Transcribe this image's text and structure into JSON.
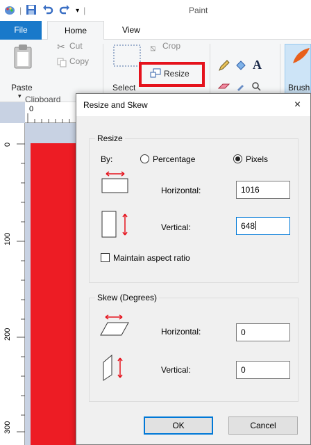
{
  "window": {
    "title": "Paint"
  },
  "ribbon_tabs": {
    "file": "File",
    "home": "Home",
    "view": "View"
  },
  "ribbon": {
    "paste": "Paste",
    "cut": "Cut",
    "copy": "Copy",
    "select": "Select",
    "crop": "Crop",
    "resize": "Resize",
    "clipboard_group": "Clipboard",
    "brushes": "Brush"
  },
  "rulers": {
    "top_zero": "0",
    "left_marks": [
      "0",
      "100",
      "200",
      "300"
    ]
  },
  "dialog": {
    "title": "Resize and Skew",
    "close": "×",
    "resize_group": {
      "label": "Resize",
      "by_label": "By:",
      "percentage": "Percentage",
      "pixels": "Pixels",
      "selected": "Pixels",
      "horizontal_label": "Horizontal:",
      "horizontal_value": "1016",
      "vertical_label": "Vertical:",
      "vertical_value": "648",
      "maintain_aspect": "Maintain aspect ratio",
      "maintain_aspect_checked": false
    },
    "skew_group": {
      "label": "Skew (Degrees)",
      "horizontal_label": "Horizontal:",
      "horizontal_value": "0",
      "vertical_label": "Vertical:",
      "vertical_value": "0"
    },
    "ok": "OK",
    "cancel": "Cancel"
  },
  "colors": {
    "accent": "#1979ca",
    "highlight": "#e5121c",
    "canvas": "#ed1c24",
    "arrow": "#e5121c",
    "focus": "#0078d7"
  }
}
